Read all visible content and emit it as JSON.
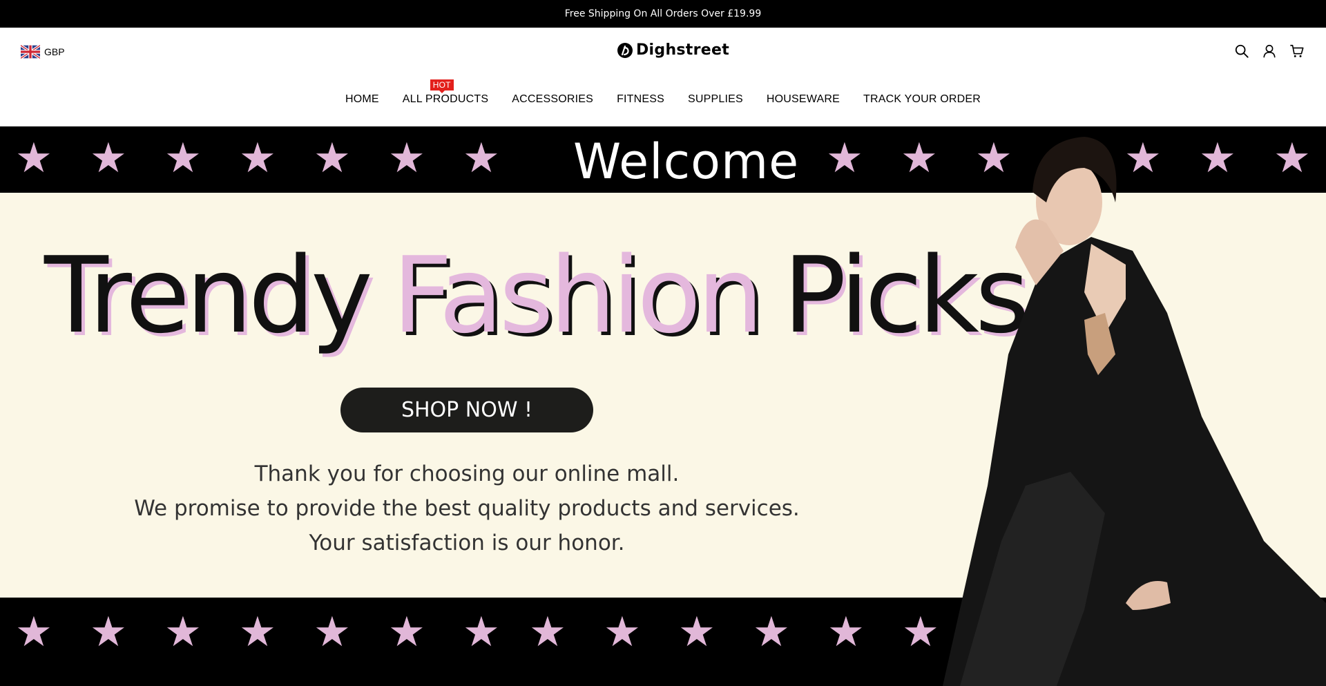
{
  "announcement": {
    "text": "​Free Shipping On All Orders Over £19.99​"
  },
  "header": {
    "currency": {
      "code": "GBP",
      "flag": "united-kingdom-flag"
    },
    "logo": {
      "text": "Dighstreet",
      "mark": "dighstreet-logo-mark"
    },
    "icons": [
      "search-icon",
      "account-icon",
      "cart-icon"
    ]
  },
  "nav": {
    "items": [
      {
        "label": "HOME"
      },
      {
        "label": "ALL PRODUCTS",
        "badge": "HOT"
      },
      {
        "label": "ACCESSORIES"
      },
      {
        "label": "FITNESS"
      },
      {
        "label": "SUPPLIES"
      },
      {
        "label": "HOUSEWARE"
      },
      {
        "label": "TRACK YOUR ORDER"
      }
    ],
    "badge_color": "#e3201c"
  },
  "hero": {
    "welcome": "Welcome",
    "headline_words": [
      "Trendy",
      "Fashion",
      "Picks"
    ],
    "cta": "SHOP NOW !",
    "thanks": {
      "line1": "Thank you for choosing our online mall.",
      "line2": "We promise to provide the best quality products and services.",
      "line3": "Your satisfaction is our honor."
    },
    "colors": {
      "accent_pink": "#e1b7d8",
      "band": "#000000",
      "background": "#fbf7e6",
      "button": "#1d1d1b"
    }
  }
}
